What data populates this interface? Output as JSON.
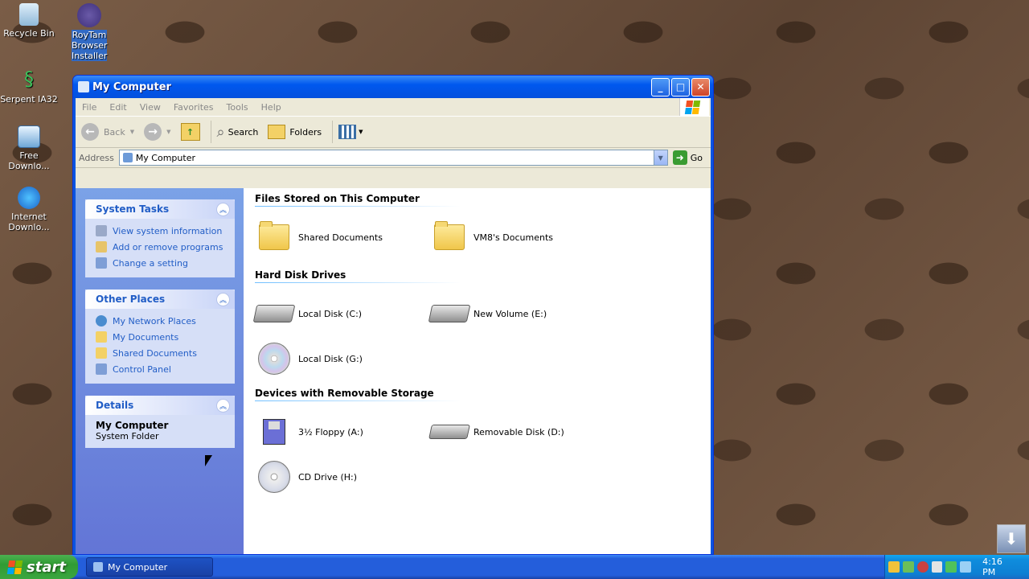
{
  "desktop": {
    "icons": [
      {
        "label": "Recycle Bin"
      },
      {
        "label": "RoyTam Browser Installer"
      },
      {
        "label": "Serpent IA32"
      },
      {
        "label": "Free Downlo..."
      },
      {
        "label": "Internet Downlo..."
      }
    ]
  },
  "window": {
    "title": "My Computer",
    "menu": [
      "File",
      "Edit",
      "View",
      "Favorites",
      "Tools",
      "Help"
    ],
    "toolbar": {
      "back": "Back",
      "search": "Search",
      "folders": "Folders"
    },
    "address": {
      "label": "Address",
      "value": "My Computer",
      "go": "Go"
    },
    "side": {
      "system_tasks": {
        "title": "System Tasks",
        "items": [
          "View system information",
          "Add or remove programs",
          "Change a setting"
        ]
      },
      "other_places": {
        "title": "Other Places",
        "items": [
          "My Network Places",
          "My Documents",
          "Shared Documents",
          "Control Panel"
        ]
      },
      "details": {
        "title": "Details",
        "name": "My Computer",
        "type": "System Folder"
      }
    },
    "groups": {
      "files": {
        "title": "Files Stored on This Computer",
        "items": [
          "Shared Documents",
          "VM8's Documents"
        ]
      },
      "hdd": {
        "title": "Hard Disk Drives",
        "items": [
          "Local Disk (C:)",
          "New Volume (E:)",
          "Local Disk (G:)"
        ]
      },
      "removable": {
        "title": "Devices with Removable Storage",
        "items": [
          "3½ Floppy (A:)",
          "Removable Disk (D:)",
          "CD Drive (H:)"
        ]
      }
    }
  },
  "taskbar": {
    "start": "start",
    "task": "My Computer",
    "clock": "4:16 PM"
  },
  "colors": {
    "link": "#215dc6",
    "title_blue": "#0058ee",
    "start_green": "#309b33"
  }
}
